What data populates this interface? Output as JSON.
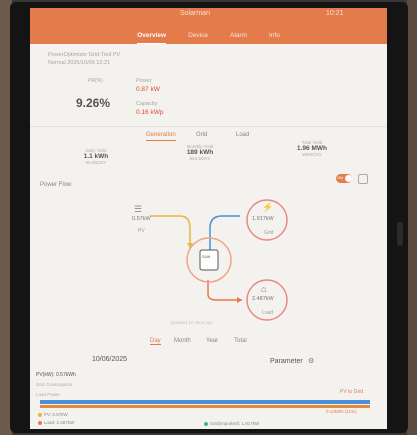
{
  "status": {
    "title": "Solarman",
    "right": "10:21"
  },
  "tabs": [
    "Overview",
    "Device",
    "Alarm",
    "Info"
  ],
  "plant": {
    "line1": "PowerOptimizer Grid-Tied PV",
    "line2": "Normal  2025/10/06 12:21"
  },
  "summary": {
    "percent": "9.26%",
    "percent_label": "PR(%)",
    "power_label": "Power",
    "power_value": "0.87 kW",
    "energy_label": "Capacity",
    "energy_value": "0.16 kWp"
  },
  "subtabs": [
    "Generation",
    "Grid",
    "Load"
  ],
  "stats": [
    {
      "label": "Daily Yield",
      "value": "1.1 kWh",
      "sub": "¥0.55CNY"
    },
    {
      "label": "Monthly Yield",
      "value": "189 kWh",
      "sub": "¥94.5CNY"
    },
    {
      "label": "Total Yield",
      "value": "1.96 MWh",
      "sub": "¥980CNY"
    }
  ],
  "flow": {
    "title": "Power Flow",
    "toggle_text": "ON",
    "pv_value": "0.57kW",
    "pv_label": "PV",
    "inverter_label": "SUN",
    "grid_value": "1.917kW",
    "grid_label": "Grid",
    "load_value": "2.487kW",
    "load_label": "Load",
    "footer": "Updated 10 mins ago"
  },
  "range_tabs": [
    "Day",
    "Month",
    "Year",
    "Total"
  ],
  "date": "10/06/2025",
  "parameter_label": "Parameter",
  "chart_head": "PV(kW): 0.57kWh",
  "chart_sub1": "Grid Consumption",
  "chart_sub2": "Load Power",
  "chart_right_label": "PV to Grid",
  "chart_right_value": "0.13kWh (11%)",
  "legend": {
    "pv": "PV: 0.57kW",
    "load": "Load: 2.487kW",
    "grid": "Grid(imported): 1.917kW"
  },
  "colors": {
    "accent": "#e37b4a",
    "red": "#e04a2b",
    "blue": "#4a8fd8"
  }
}
